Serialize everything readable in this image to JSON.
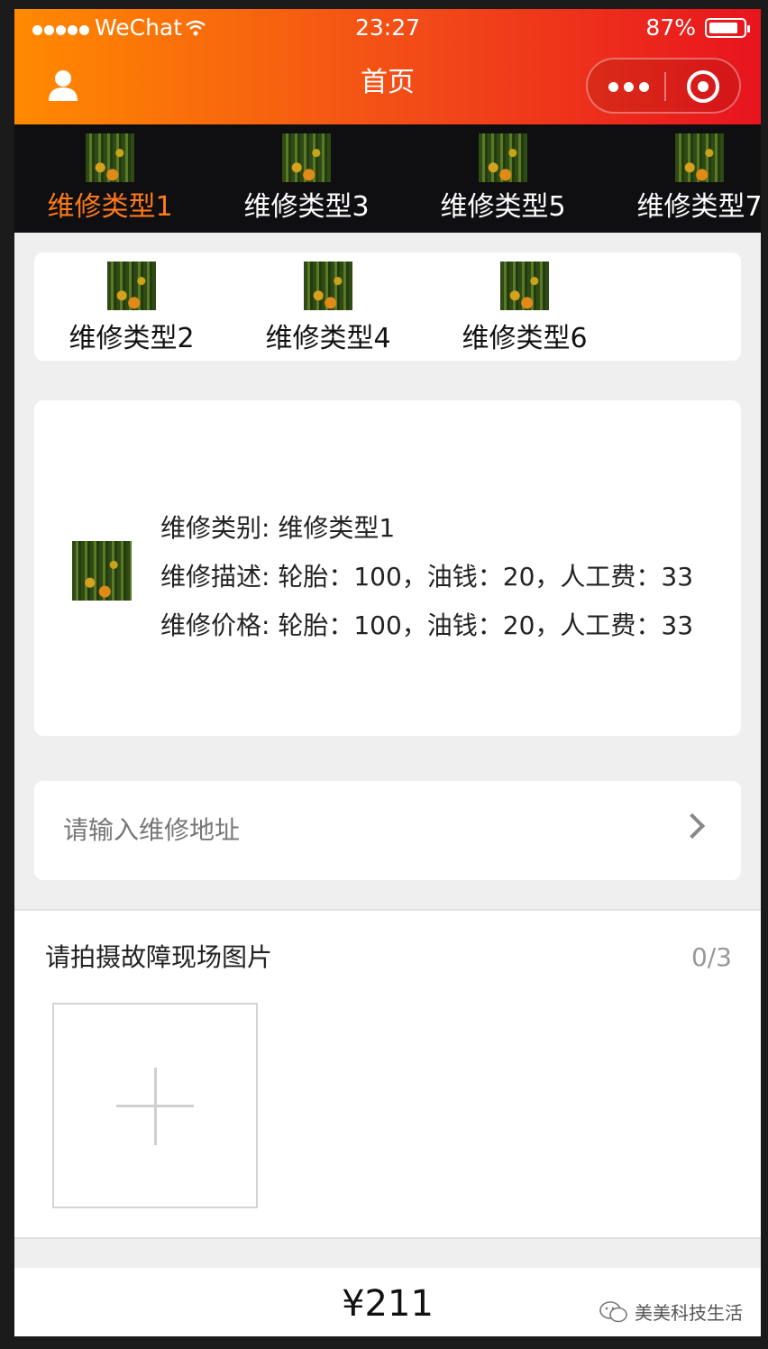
{
  "status_bar": {
    "carrier": "WeChat",
    "time": "23:27",
    "battery": "87%",
    "battery_level": 0.87
  },
  "nav": {
    "title": "首页"
  },
  "top_tabs": [
    {
      "label": "维修类型1",
      "active": true
    },
    {
      "label": "维修类型3",
      "active": false
    },
    {
      "label": "维修类型5",
      "active": false
    },
    {
      "label": "维修类型7",
      "active": false
    }
  ],
  "sub_tabs": [
    {
      "label": "维修类型2"
    },
    {
      "label": "维修类型4"
    },
    {
      "label": "维修类型6"
    }
  ],
  "detail": {
    "category": "维修类别: 维修类型1",
    "description": "维修描述: 轮胎：100，油钱：20，人工费：33",
    "price": "维修价格: 轮胎：100，油钱：20，人工费：33"
  },
  "address": {
    "placeholder": "请输入维修地址"
  },
  "photo": {
    "title": "请拍摄故障现场图片",
    "count": "0/3"
  },
  "footer": {
    "total": "¥211",
    "watermark": "美美科技生活"
  },
  "colors": {
    "accent": "#ff7a1a",
    "header_start": "#ff8a00",
    "header_end": "#e8141e"
  }
}
